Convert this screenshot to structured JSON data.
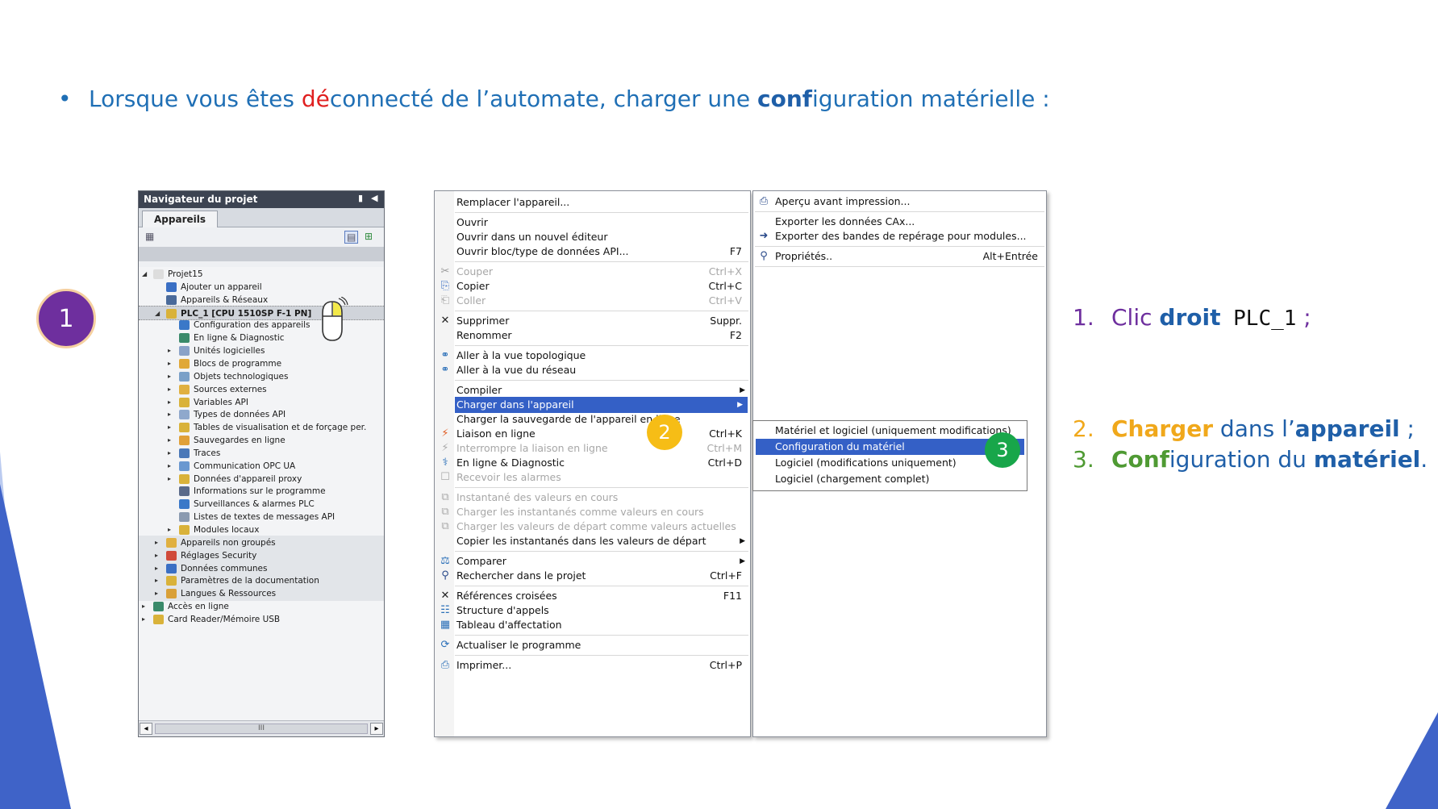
{
  "headline": {
    "bullet": "•",
    "part1": "Lorsque vous êtes ",
    "red": "dé",
    "part2": "connecté de l’automate, charger une ",
    "bold": "conf",
    "part3": "iguration matérielle :"
  },
  "badges": {
    "one": "1",
    "two": "2",
    "three": "3"
  },
  "navigator": {
    "title": "Navigateur du projet",
    "tab": "Appareils",
    "scroll_thumb": "III",
    "tree": [
      "Projet15",
      "Ajouter un appareil",
      "Appareils & Réseaux",
      "PLC_1 [CPU 1510SP F-1 PN]",
      "Configuration des appareils",
      "En ligne & Diagnostic",
      "Unités logicielles",
      "Blocs de programme",
      "Objets technologiques",
      "Sources externes",
      "Variables API",
      "Types de données API",
      "Tables de visualisation et de forçage per.",
      "Sauvegardes en ligne",
      "Traces",
      "Communication OPC UA",
      "Données d'appareil proxy",
      "Informations sur le programme",
      "Surveillances & alarmes PLC",
      "Listes de textes de messages API",
      "Modules locaux",
      "Appareils non groupés",
      "Réglages Security",
      "Données communes",
      "Paramètres de la documentation",
      "Langues & Ressources",
      "Accès en ligne",
      "Card Reader/Mémoire USB"
    ]
  },
  "context_menu": {
    "items": [
      {
        "label": "Remplacer l'appareil...",
        "shortcut": ""
      },
      {
        "label": "Ouvrir",
        "shortcut": ""
      },
      {
        "label": "Ouvrir dans un nouvel éditeur",
        "shortcut": ""
      },
      {
        "label": "Ouvrir bloc/type de données API...",
        "shortcut": "F7"
      },
      {
        "label": "Couper",
        "shortcut": "Ctrl+X"
      },
      {
        "label": "Copier",
        "shortcut": "Ctrl+C"
      },
      {
        "label": "Coller",
        "shortcut": "Ctrl+V"
      },
      {
        "label": "Supprimer",
        "shortcut": "Suppr."
      },
      {
        "label": "Renommer",
        "shortcut": "F2"
      },
      {
        "label": "Aller à la vue topologique",
        "shortcut": ""
      },
      {
        "label": "Aller à la vue du réseau",
        "shortcut": ""
      },
      {
        "label": "Compiler",
        "shortcut": ""
      },
      {
        "label": "Charger dans l'appareil",
        "shortcut": ""
      },
      {
        "label": "Charger la sauvegarde de l'appareil en ligne",
        "shortcut": ""
      },
      {
        "label": "Liaison en ligne",
        "shortcut": "Ctrl+K"
      },
      {
        "label": "Interrompre la liaison en ligne",
        "shortcut": "Ctrl+M"
      },
      {
        "label": "En ligne & Diagnostic",
        "shortcut": "Ctrl+D"
      },
      {
        "label": "Recevoir les alarmes",
        "shortcut": ""
      },
      {
        "label": "Instantané des valeurs en cours",
        "shortcut": ""
      },
      {
        "label": "Charger les instantanés comme valeurs en cours",
        "shortcut": ""
      },
      {
        "label": "Charger les valeurs de départ comme valeurs actuelles",
        "shortcut": ""
      },
      {
        "label": "Copier les instantanés dans les valeurs de départ",
        "shortcut": ""
      },
      {
        "label": "Comparer",
        "shortcut": ""
      },
      {
        "label": "Rechercher dans le projet",
        "shortcut": "Ctrl+F"
      },
      {
        "label": "Références croisées",
        "shortcut": "F11"
      },
      {
        "label": "Structure d'appels",
        "shortcut": ""
      },
      {
        "label": "Tableau d'affectation",
        "shortcut": ""
      },
      {
        "label": "Actualiser le programme",
        "shortcut": ""
      },
      {
        "label": "Imprimer...",
        "shortcut": "Ctrl+P"
      }
    ]
  },
  "context_menu_right": {
    "items": [
      {
        "label": "Aperçu avant impression...",
        "shortcut": ""
      },
      {
        "label": "Exporter les données CAx...",
        "shortcut": ""
      },
      {
        "label": "Exporter des bandes de repérage pour modules...",
        "shortcut": ""
      },
      {
        "label": "Propriétés..",
        "shortcut": "Alt+Entrée"
      }
    ]
  },
  "submenu": {
    "items": [
      "Matériel et logiciel (uniquement modifications)",
      "Configuration du matériel",
      "Logiciel (modifications uniquement)",
      "Logiciel (chargement complet)"
    ]
  },
  "steps": {
    "s1_num": "1.",
    "s1_a": "Clic ",
    "s1_b": "droit",
    "s1_c": " PLC_1",
    "s1_d": " ;",
    "s2_num": "2.",
    "s2_a": "Charger",
    "s2_b": " dans l’",
    "s2_c": "appareil",
    "s2_d": " ;",
    "s3_num": "3.",
    "s3_a": "Conf",
    "s3_b": "iguration du ",
    "s3_c": "matériel",
    "s3_d": "."
  },
  "colors": {
    "accent_blue": "#1f5fa8",
    "purple": "#6e2f9e",
    "orange": "#f0a81b",
    "green": "#4f9a33",
    "highlight": "#3460c6"
  }
}
